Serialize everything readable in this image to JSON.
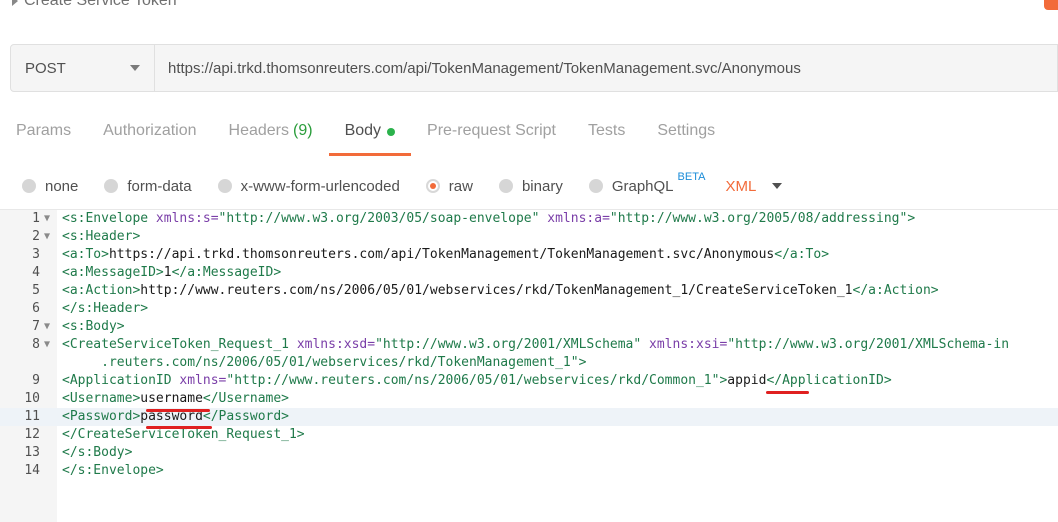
{
  "request": {
    "title": "Create Service Token",
    "method": "POST",
    "url": "https://api.trkd.thomsonreuters.com/api/TokenManagement/TokenManagement.svc/Anonymous"
  },
  "tabs": [
    {
      "label": "Params"
    },
    {
      "label": "Authorization"
    },
    {
      "label": "Headers",
      "count": "(9)"
    },
    {
      "label": "Body"
    },
    {
      "label": "Pre-request Script"
    },
    {
      "label": "Tests"
    },
    {
      "label": "Settings"
    }
  ],
  "body_options": {
    "none": "none",
    "form_data": "form-data",
    "urlencoded": "x-www-form-urlencoded",
    "raw": "raw",
    "binary": "binary",
    "graphql": "GraphQL",
    "beta": "BETA",
    "format": "XML"
  },
  "editor": {
    "line_numbers": [
      "1",
      "2",
      "3",
      "4",
      "5",
      "6",
      "7",
      "8",
      "",
      "9",
      "10",
      "11",
      "12",
      "13",
      "14"
    ],
    "highlighted_line": "11"
  },
  "colors": {
    "accent": "#f26b3a",
    "tag": "#1f7a4a",
    "attr": "#7a3ea8",
    "ok": "#2bb24c"
  }
}
